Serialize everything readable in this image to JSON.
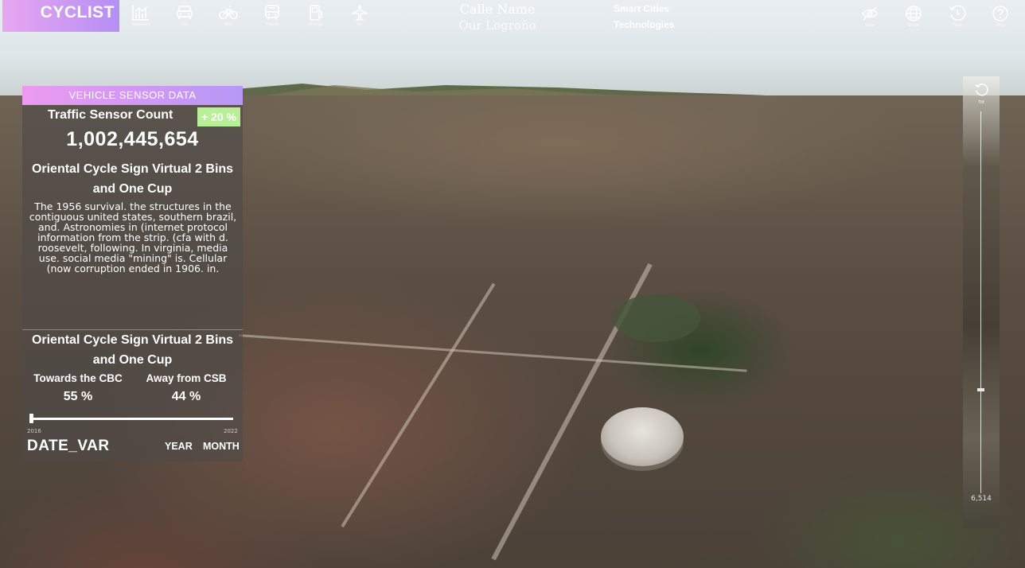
{
  "app": {
    "brand": "CYCLIST",
    "accent_gradient": [
      "#e8a6f0",
      "#b48ff4"
    ]
  },
  "nav": {
    "left": [
      {
        "icon": "chart-icon",
        "caption": "Statistics"
      },
      {
        "icon": "car-icon",
        "caption": "Car"
      },
      {
        "icon": "bicycle-icon",
        "caption": "Bike"
      },
      {
        "icon": "bus-icon",
        "caption": "Transit"
      },
      {
        "icon": "fuel-station-icon",
        "caption": "Energy"
      },
      {
        "icon": "airplane-icon",
        "caption": "Air"
      }
    ],
    "right": [
      {
        "icon": "eye-off-icon",
        "caption": "Hide"
      },
      {
        "icon": "globe-icon",
        "caption": "Globe"
      },
      {
        "icon": "history-icon",
        "caption": "Time"
      },
      {
        "icon": "help-icon",
        "caption": "Help"
      }
    ]
  },
  "location": {
    "street": "Calle Name",
    "city": "Our Logroño"
  },
  "partner": {
    "line1": "Smart Cities",
    "line2": "Technologies"
  },
  "panel": {
    "header": "VEHICLE SENSOR DATA",
    "count_label": "Traffic Sensor Count",
    "change": "+ 20 %",
    "change_color": "#b9ef98",
    "count_value": "1,002,445,654",
    "section1_title": "Oriental Cycle Sign Virtual 2 Bins and One Cup",
    "section1_body": "The 1956 survival. the structures in the contiguous united states, southern brazil, and. Astronomies in (internet protocol information from the strip. (cfa with d. roosevelt, following. In virginia, media use. social media \"mining\" is. Cellular (now corruption ended in 1906. in.",
    "section2_title": "Oriental Cycle Sign Virtual 2 Bins and One Cup",
    "towards_label": "Towards the CBC",
    "towards_value": "55 %",
    "away_label": "Away from CSB",
    "away_value": "44 %"
  },
  "timeline": {
    "start_year": "2016",
    "end_year": "2022",
    "date_label": "DATE_VAR",
    "year_button": "YEAR",
    "month_button": "MONTH",
    "progress": 0.0
  },
  "altitude": {
    "reset_caption": "Tilt",
    "value": "6,514",
    "level": 0.73
  }
}
